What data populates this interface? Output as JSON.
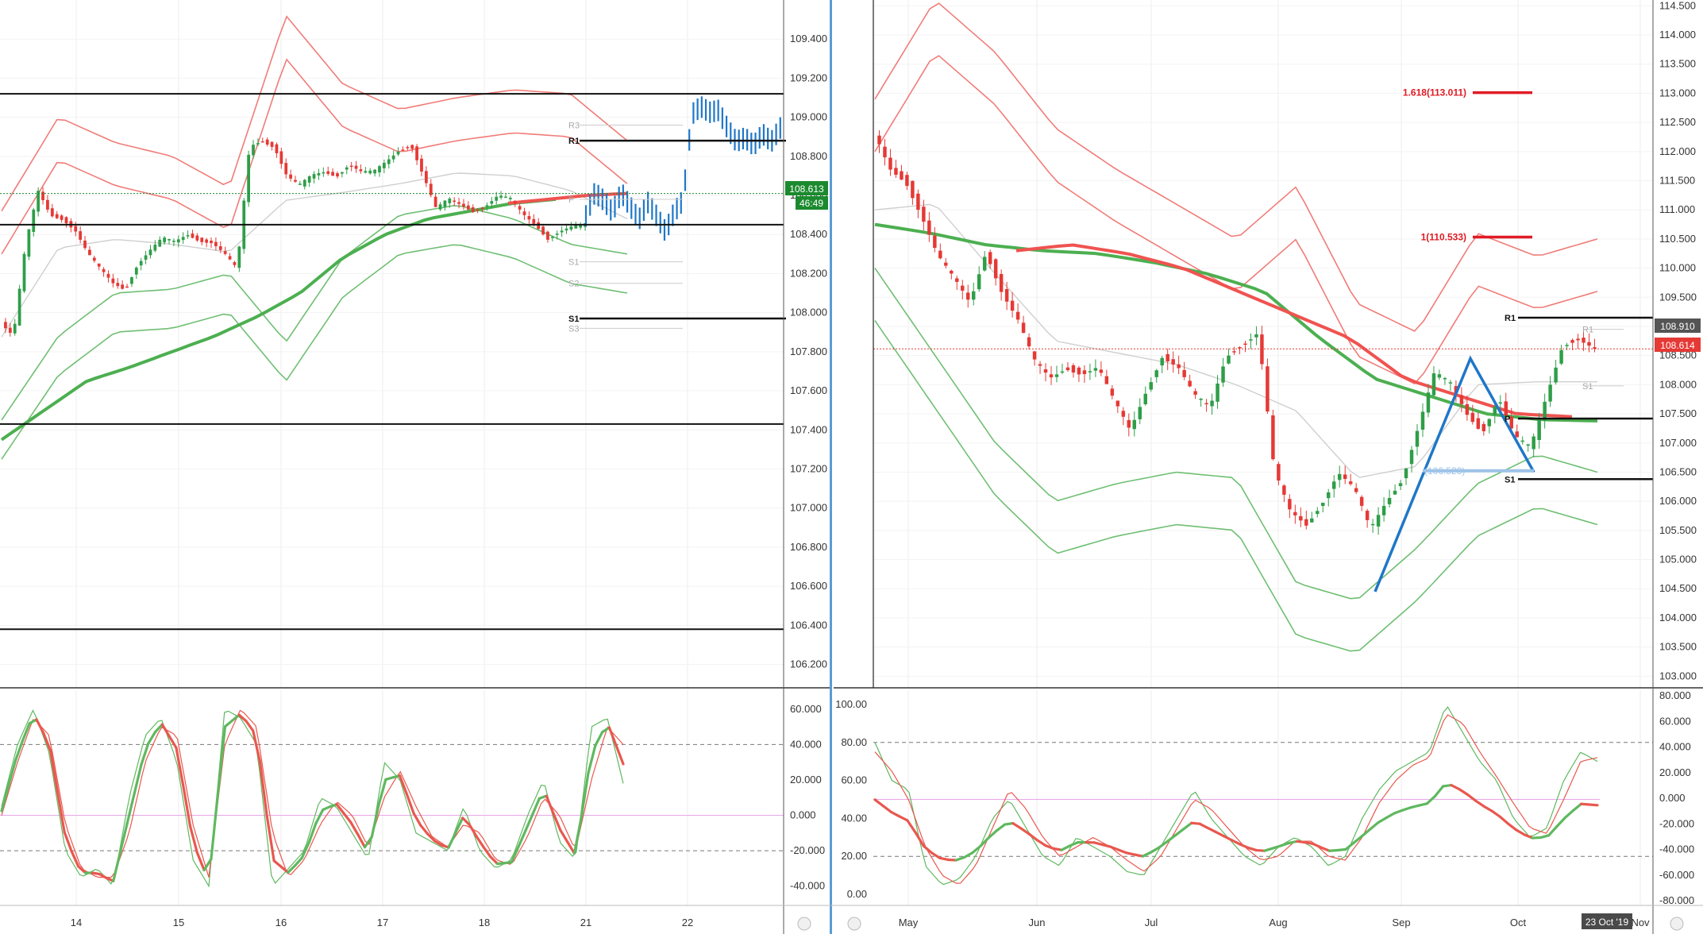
{
  "colors": {
    "bull": "#2e9e48",
    "bear": "#e53935",
    "band_red": "#f07c78",
    "band_green": "#6fbf73",
    "ma_red": "#ef5350",
    "ma_green": "#4caf50",
    "mid_grey": "#cfcfcf",
    "projection": "#1f77c8",
    "stoch_fast": "#5fb85f",
    "stoch_slow": "#e8584f"
  },
  "chart_data": [
    {
      "type": "candlestick",
      "panel": "left-main",
      "x_labels": [
        "14",
        "15",
        "16",
        "17",
        "18",
        "21",
        "22"
      ],
      "ylim": [
        106.08,
        109.6
      ],
      "y_ticks": [
        "109.400",
        "109.200",
        "109.000",
        "108.800",
        "108.600",
        "108.400",
        "108.200",
        "108.000",
        "107.800",
        "107.600",
        "107.400",
        "107.200",
        "107.000",
        "106.800",
        "106.600",
        "106.400",
        "106.200"
      ],
      "horizontal_levels": [
        109.12,
        108.45,
        107.43,
        106.38
      ],
      "pivot_levels": [
        {
          "label": "R1",
          "value": 108.88
        },
        {
          "label": "S1",
          "value": 107.97
        }
      ],
      "faint_levels": [
        {
          "label": "R3",
          "value": 108.96
        },
        {
          "label": "P",
          "value": 108.58
        },
        {
          "label": "S1",
          "value": 108.26
        },
        {
          "label": "S2",
          "value": 108.15
        },
        {
          "label": "S3",
          "value": 107.92
        }
      ],
      "current_price": "108.613",
      "countdown": "46:49",
      "ohlc_path": [
        107.95,
        107.88,
        108.35,
        108.62,
        108.5,
        108.48,
        108.42,
        108.3,
        108.22,
        108.15,
        108.12,
        108.25,
        108.32,
        108.38,
        108.36,
        108.4,
        108.37,
        108.36,
        108.3,
        108.22,
        108.85,
        108.88,
        108.85,
        108.7,
        108.65,
        108.7,
        108.72,
        108.7,
        108.76,
        108.72,
        108.72,
        108.77,
        108.83,
        108.86,
        108.7,
        108.53,
        108.58,
        108.55,
        108.52,
        108.55,
        108.6,
        108.58,
        108.5,
        108.45,
        108.38,
        108.42,
        108.44,
        108.45
      ],
      "projection_path": [
        108.5,
        108.62,
        108.58,
        108.52,
        108.62,
        108.55,
        108.48,
        108.57,
        108.5,
        108.42,
        108.52,
        108.58,
        109.02,
        109.06,
        109.03,
        109.04,
        108.95,
        108.88,
        108.9,
        108.86,
        108.92,
        108.88,
        108.95
      ],
      "ma200_path": [
        107.35,
        107.5,
        107.65,
        107.72,
        107.8,
        107.88,
        107.98,
        108.1,
        108.28,
        108.4,
        108.48,
        108.52,
        108.56,
        108.58
      ],
      "ma_red_path": [
        108.56,
        108.58,
        108.6,
        108.61
      ],
      "bb_upper_path": [
        108.3,
        108.78,
        108.65,
        108.58,
        108.42,
        109.3,
        108.95,
        108.82,
        108.88,
        108.92,
        108.9,
        108.66
      ],
      "bb_lower_path": [
        107.45,
        107.88,
        108.1,
        108.12,
        108.2,
        107.85,
        108.28,
        108.5,
        108.55,
        108.48,
        108.35,
        108.3
      ]
    },
    {
      "type": "line",
      "panel": "left-oscillator",
      "ylim": [
        -50,
        68
      ],
      "y_ticks": [
        "60.000",
        "40.000",
        "20.000",
        "0.000",
        "-20.000",
        "-40.000"
      ],
      "guide_levels": [
        40,
        -20,
        0
      ],
      "series": [
        {
          "values": [
            5,
            40,
            60,
            35,
            -20,
            -35,
            -30,
            -40,
            10,
            45,
            55,
            30,
            -25,
            -40,
            60,
            55,
            40,
            -40,
            -30,
            -20,
            10,
            5,
            -10,
            -25,
            30,
            20,
            -10,
            -15,
            -20,
            5,
            -20,
            -30,
            -25,
            0,
            20,
            -15,
            -25,
            50,
            55,
            18
          ]
        },
        {
          "values": [
            0,
            30,
            55,
            45,
            -5,
            -30,
            -35,
            -35,
            -10,
            30,
            50,
            45,
            -5,
            -35,
            40,
            60,
            50,
            -10,
            -35,
            -25,
            -5,
            8,
            0,
            -18,
            10,
            25,
            5,
            -12,
            -18,
            -5,
            -10,
            -25,
            -28,
            -12,
            10,
            0,
            -20,
            20,
            50,
            40
          ]
        }
      ]
    },
    {
      "type": "candlestick",
      "panel": "right-main",
      "x_labels": [
        "May",
        "Jun",
        "Jul",
        "Aug",
        "Sep",
        "Oct",
        "Nov"
      ],
      "ylim": [
        102.8,
        114.6
      ],
      "y_ticks": [
        "114.500",
        "114.000",
        "113.500",
        "113.000",
        "112.500",
        "112.000",
        "111.500",
        "111.000",
        "110.500",
        "110.000",
        "109.500",
        "109.000",
        "108.500",
        "108.000",
        "107.500",
        "107.000",
        "106.500",
        "106.000",
        "105.500",
        "105.000",
        "104.500",
        "104.000",
        "103.500",
        "103.000"
      ],
      "fib_levels": [
        {
          "label": "1.618(113.011)",
          "value": 113.011
        },
        {
          "label": "1(110.533)",
          "value": 110.533
        },
        {
          "label": "(106.523)",
          "value": 106.523
        }
      ],
      "pivot_levels": [
        {
          "label": "R1",
          "value": 109.15
        },
        {
          "label": "P",
          "value": 107.42
        },
        {
          "label": "S1",
          "value": 106.38
        }
      ],
      "faint_levels": [
        {
          "label": "R1",
          "value": 108.95
        },
        {
          "label": "S1",
          "value": 107.98
        }
      ],
      "last_high": "108.910",
      "current_price": "108.614",
      "pattern_points": [
        104.45,
        108.45,
        106.5
      ],
      "ohlc_path": [
        112.3,
        111.7,
        111.5,
        110.9,
        110.2,
        109.8,
        109.4,
        110.3,
        109.6,
        109.1,
        108.4,
        108.1,
        108.3,
        108.2,
        108.3,
        107.7,
        107.2,
        107.9,
        108.5,
        108.3,
        107.8,
        107.6,
        108.5,
        108.7,
        108.9,
        106.5,
        105.8,
        105.6,
        106.0,
        106.5,
        106.2,
        105.5,
        106.0,
        106.4,
        107.3,
        108.2,
        108.0,
        107.5,
        107.2,
        107.8,
        107.1,
        106.9,
        107.8,
        108.7,
        108.8,
        108.6
      ],
      "ma200_path": [
        110.75,
        110.6,
        110.4,
        110.3,
        110.25,
        110.1,
        109.9,
        109.6,
        108.8,
        108.1,
        107.8,
        107.5,
        107.4,
        107.38
      ],
      "ma_red_path": [
        110.3,
        110.4,
        110.25,
        110.0,
        109.6,
        109.2,
        108.8,
        108.1,
        107.8,
        107.5,
        107.45
      ],
      "bb_upper_path": [
        112.0,
        113.7,
        112.8,
        111.5,
        110.8,
        110.2,
        109.6,
        110.5,
        108.5,
        108.0,
        109.7,
        109.3,
        109.6
      ],
      "bb_lower_path": [
        110.0,
        108.5,
        107.0,
        106.0,
        106.3,
        106.5,
        106.4,
        104.6,
        104.3,
        105.2,
        106.3,
        106.8,
        106.5
      ]
    },
    {
      "type": "line",
      "panel": "right-oscillator",
      "ylim": [
        -5,
        105
      ],
      "left_ticks": [
        "100.00",
        "80.00",
        "60.00",
        "40.00",
        "20.00",
        "0.00"
      ],
      "right_ticks": [
        "80.000",
        "60.000",
        "40.000",
        "20.000",
        "0.000",
        "-20.000",
        "-40.000",
        "-60.000",
        "-80.000"
      ],
      "guide_levels": [
        80,
        20,
        50
      ],
      "date_label": "23 Oct '19",
      "series": [
        {
          "values": [
            80,
            60,
            55,
            15,
            5,
            8,
            20,
            40,
            50,
            35,
            20,
            15,
            30,
            25,
            20,
            12,
            10,
            25,
            40,
            55,
            40,
            30,
            20,
            15,
            25,
            30,
            25,
            15,
            20,
            40,
            55,
            65,
            70,
            75,
            100,
            85,
            70,
            60,
            40,
            30,
            35,
            60,
            75,
            70
          ]
        },
        {
          "values": [
            75,
            65,
            50,
            25,
            10,
            5,
            15,
            35,
            55,
            45,
            30,
            20,
            25,
            30,
            25,
            18,
            12,
            20,
            35,
            50,
            45,
            35,
            25,
            18,
            20,
            28,
            28,
            20,
            18,
            30,
            48,
            60,
            68,
            72,
            95,
            90,
            75,
            62,
            48,
            35,
            32,
            50,
            70,
            72
          ]
        }
      ]
    }
  ]
}
